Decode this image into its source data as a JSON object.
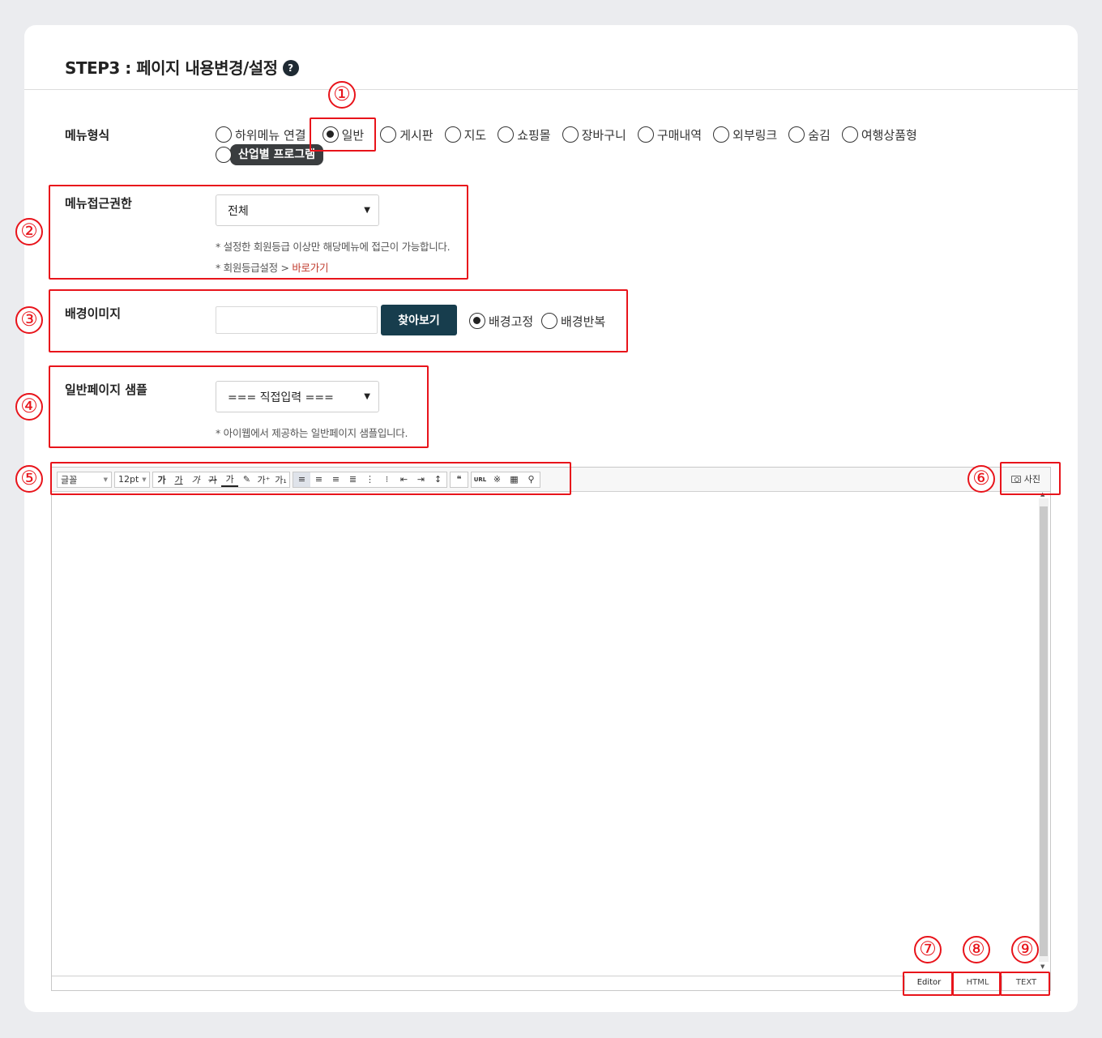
{
  "header": {
    "title": "STEP3 : 페이지 내용변경/설정",
    "help_icon": "?"
  },
  "menu_type": {
    "label": "메뉴형식",
    "options": [
      {
        "label": "하위메뉴 연결",
        "checked": false
      },
      {
        "label": "일반",
        "checked": true
      },
      {
        "label": "게시판",
        "checked": false
      },
      {
        "label": "지도",
        "checked": false
      },
      {
        "label": "쇼핑몰",
        "checked": false
      },
      {
        "label": "장바구니",
        "checked": false
      },
      {
        "label": "구매내역",
        "checked": false
      },
      {
        "label": "외부링크",
        "checked": false
      },
      {
        "label": "숨김",
        "checked": false
      },
      {
        "label": "여행상품형",
        "checked": false
      }
    ],
    "tooltip_option": "산업별 프로그램"
  },
  "access": {
    "label": "메뉴접근권한",
    "selected": "전체",
    "note1": "* 설정한 회원등급 이상만 해당메뉴에 접근이 가능합니다.",
    "note2_prefix": "* 회원등급설정 > ",
    "note2_link": "바로가기"
  },
  "background": {
    "label": "배경이미지",
    "input_value": "",
    "browse_label": "찾아보기",
    "fixed_label": "배경고정",
    "repeat_label": "배경반복"
  },
  "sample": {
    "label": "일반페이지 샘플",
    "selected": "=== 직접입력 ===",
    "note": "* 아이웹에서 제공하는 일반페이지 샘플입니다."
  },
  "editor": {
    "font_select": "글꼴",
    "size_select": "12pt",
    "toolbar_buttons": [
      "가",
      "가",
      "가",
      "가",
      "가",
      "가⁺",
      "가₁"
    ],
    "insert_buttons": [
      "URL"
    ],
    "photo_label": "사진",
    "modes": [
      "Editor",
      "HTML",
      "TEXT"
    ]
  },
  "annotations": [
    "①",
    "②",
    "③",
    "④",
    "⑤",
    "⑥",
    "⑦",
    "⑧",
    "⑨"
  ]
}
